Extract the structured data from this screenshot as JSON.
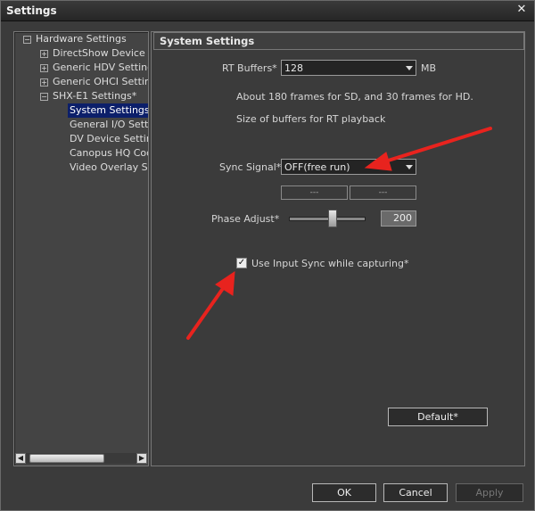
{
  "window": {
    "title": "Settings",
    "close_label": "✕"
  },
  "tree": {
    "root": "Hardware Settings",
    "items": [
      {
        "label": "DirectShow Device Set",
        "expander": "+"
      },
      {
        "label": "Generic HDV Settings",
        "expander": "+"
      },
      {
        "label": "Generic OHCI Settings",
        "expander": "+"
      },
      {
        "label": "SHX-E1 Settings*",
        "expander": "−"
      }
    ],
    "children": [
      "System Settings",
      "General I/O Settin",
      "DV Device Settings",
      "Canopus HQ Code",
      "Video Overlay Set"
    ],
    "root_expander": "−"
  },
  "scroll": {
    "left": "◀",
    "right": "▶"
  },
  "panel": {
    "header": "System Settings",
    "rt_buffers_label": "RT Buffers*",
    "rt_buffers_value": "128",
    "rt_buffers_unit": "MB",
    "info_line1": "About 180 frames for SD, and 30 frames for HD.",
    "info_line2": "Size of buffers for RT playback",
    "sync_signal_label": "Sync Signal*",
    "sync_signal_value": "OFF(free run)",
    "sync_box1": "---",
    "sync_box2": "---",
    "phase_adjust_label": "Phase Adjust*",
    "phase_adjust_value": "200",
    "phase_adjust_level": 0.58,
    "use_input_sync_label": "Use Input Sync while capturing*",
    "use_input_sync_checked": true,
    "check_mark": "✓",
    "default_button": "Default*"
  },
  "footer": {
    "ok": "OK",
    "cancel": "Cancel",
    "apply": "Apply"
  },
  "annotation_color": "#e8231e"
}
